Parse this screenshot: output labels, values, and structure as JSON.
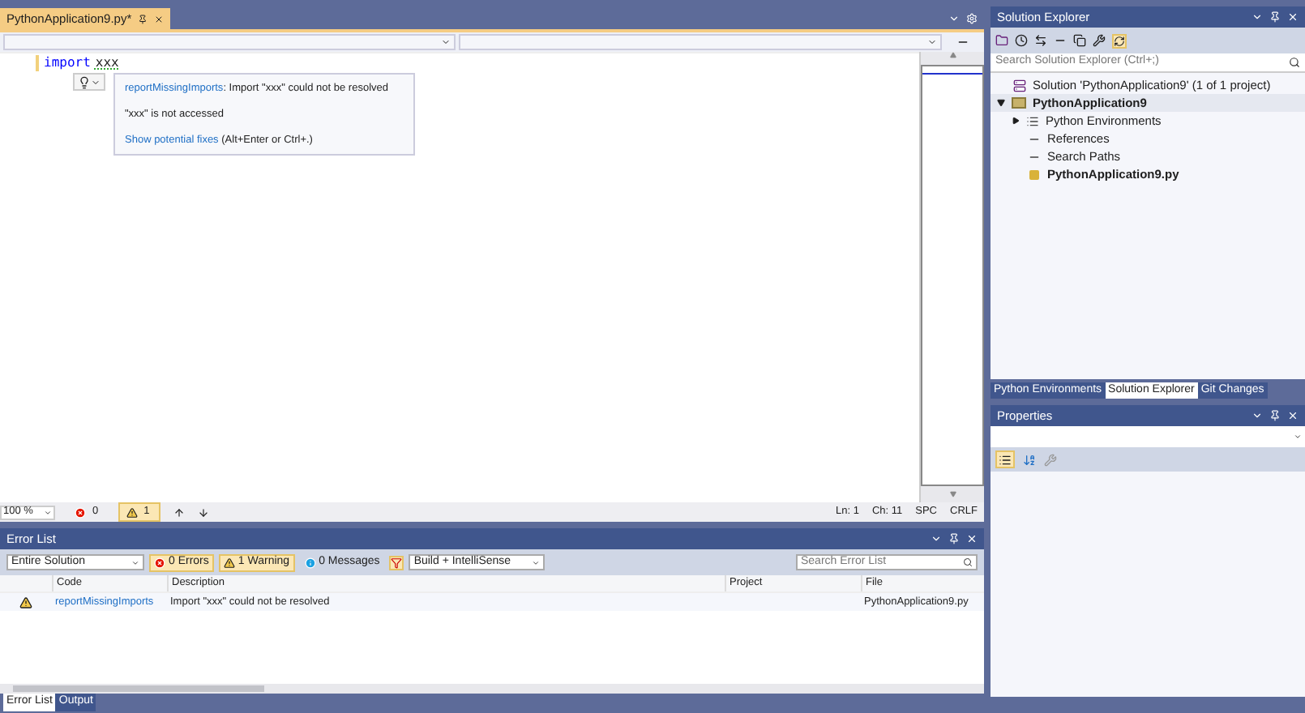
{
  "editor_tab": {
    "title": "PythonApplication9.py*",
    "selected": true
  },
  "code": [
    {
      "kind": "keyword",
      "text": "import"
    },
    {
      "kind": "identifier",
      "text": "xxx"
    }
  ],
  "quick_info": {
    "diagnostic_code": "reportMissingImports",
    "diagnostic_message": ": Import \"xxx\" could not be resolved",
    "note": "\"xxx\" is not accessed",
    "fixes_link": "Show potential fixes",
    "fixes_shortcut": "(Alt+Enter or Ctrl+.)"
  },
  "editor_status": {
    "zoom": "100 %",
    "errors": "0",
    "warnings": "1",
    "line": "Ln: 1",
    "column": "Ch: 11",
    "whitespace": "SPC",
    "line_ending": "CRLF"
  },
  "error_list": {
    "title": "Error List",
    "scope": "Entire Solution",
    "filters": [
      {
        "kind": "error",
        "label": "0 Errors",
        "selected": true
      },
      {
        "kind": "warning",
        "label": "1 Warning",
        "selected": true
      },
      {
        "kind": "message",
        "label": "0 Messages",
        "selected": false
      }
    ],
    "source": "Build + IntelliSense",
    "search_placeholder": "Search Error List",
    "columns": [
      "Code",
      "Description",
      "Project",
      "File"
    ],
    "rows": [
      {
        "kind": "warning",
        "code": "reportMissingImports",
        "description": "Import \"xxx\" could not be resolved",
        "file": "PythonApplication9.py"
      }
    ]
  },
  "bottom_tabs": [
    {
      "label": "Error List",
      "selected": true
    },
    {
      "label": "Output",
      "selected": false
    }
  ],
  "solution_explorer": {
    "title": "Solution Explorer",
    "search_placeholder": "Search Solution Explorer (Ctrl+;)",
    "tree": [
      {
        "kind": "solution",
        "label": "Solution 'PythonApplication9' (1 of 1 project)",
        "selected": false,
        "children": [
          {
            "kind": "project",
            "label": "PythonApplication9",
            "selected": true,
            "expanded": true,
            "children": [
              {
                "kind": "environments",
                "label": "Python Environments",
                "selected": false,
                "expanded": false
              },
              {
                "kind": "references",
                "label": "References",
                "selected": false
              },
              {
                "kind": "search_paths",
                "label": "Search Paths",
                "selected": false
              },
              {
                "kind": "python_file",
                "label": "PythonApplication9.py",
                "selected": false
              }
            ]
          }
        ]
      }
    ]
  },
  "panel_tabs": [
    {
      "label": "Python Environments",
      "selected": false
    },
    {
      "label": "Solution Explorer",
      "selected": true
    },
    {
      "label": "Git Changes",
      "selected": false
    }
  ],
  "properties": {
    "title": "Properties",
    "sort_buttons": [
      {
        "kind": "categorized",
        "selected": true
      },
      {
        "kind": "alphabetical",
        "selected": false
      }
    ]
  }
}
